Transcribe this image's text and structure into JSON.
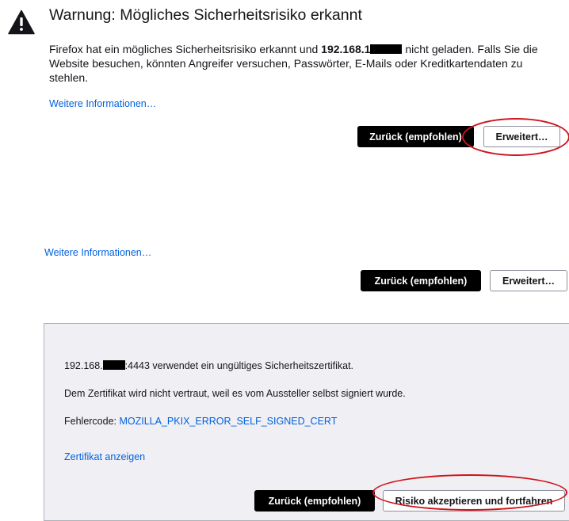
{
  "warning": {
    "title": "Warnung: Mögliches Sicherheitsrisiko erkannt",
    "desc_before": "Firefox hat ein mögliches Sicherheitsrisiko erkannt und ",
    "desc_host": "192.168.1",
    "desc_after": " nicht geladen. Falls Sie die Website besuchen, könnten Angreifer versuchen, Passwörter, E-Mails oder Kreditkartendaten zu stehlen.",
    "learn_more": "Weitere Informationen…",
    "back_button": "Zurück (empfohlen)",
    "advanced_button": "Erweitert…"
  },
  "second": {
    "learn_more": "Weitere Informationen…",
    "back_button": "Zurück (empfohlen)",
    "advanced_button": "Erweitert…"
  },
  "advanced": {
    "host_prefix": "192.168.",
    "host_suffix": ":4443 verwendet ein ungültiges Sicherheitszertifikat.",
    "self_signed": "Dem Zertifikat wird nicht vertraut, weil es vom Aussteller selbst signiert wurde.",
    "error_label": "Fehlercode: ",
    "error_code": "MOZILLA_PKIX_ERROR_SELF_SIGNED_CERT",
    "view_cert": "Zertifikat anzeigen",
    "back_button": "Zurück (empfohlen)",
    "accept_button": "Risiko akzeptieren und fortfahren"
  },
  "colors": {
    "link": "#0060df",
    "primary_button": "#000000",
    "annotation": "#d0121b",
    "panel_bg": "#f0f0f4"
  }
}
